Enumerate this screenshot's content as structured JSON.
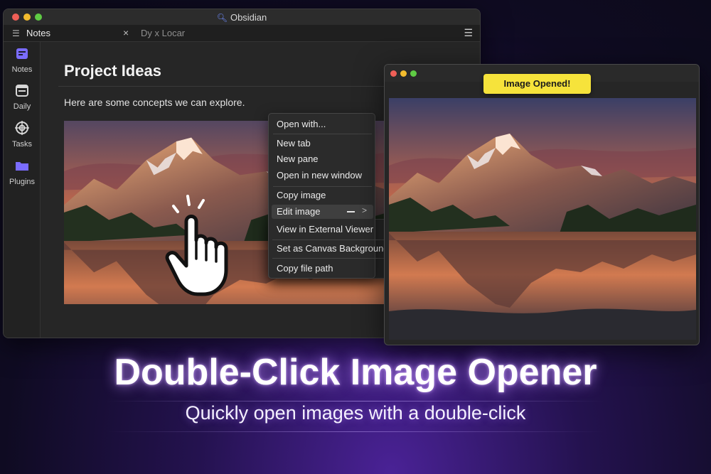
{
  "app": {
    "title": "Obsidian",
    "title_icon": "search-icon"
  },
  "tabs": {
    "active_label": "Notes",
    "close_glyph": "×",
    "other_label": "Dy x Locar",
    "menu_icon": "hamburger-icon"
  },
  "sidebar": {
    "items": [
      {
        "label": "Notes",
        "icon": "calendar-icon"
      },
      {
        "label": "Daily",
        "icon": "daily-icon"
      },
      {
        "label": "Tasks",
        "icon": "target-icon"
      },
      {
        "label": "Plugins",
        "icon": "folder-icon"
      }
    ]
  },
  "note": {
    "title": "Project Ideas",
    "body": "Here are some concepts we can explore.",
    "image_alt": "mountain-lake-image"
  },
  "context_menu": {
    "items": [
      "Open with...",
      "New tab",
      "New pane",
      "Open in new window",
      "Copy image",
      "Edit image",
      "View in External Viewer",
      "Set as Canvas Background",
      "Copy file path"
    ],
    "highlighted": "Edit image",
    "submenu_glyph": ">"
  },
  "viewer": {
    "toast": "Image Opened!"
  },
  "promo": {
    "headline": "Double-Click Image Opener",
    "subline": "Quickly open images with a double-click"
  },
  "colors": {
    "accent": "#7a6cff",
    "toast_bg": "#f6e33b",
    "glow": "#b88cff",
    "window_bg": "#262626"
  }
}
